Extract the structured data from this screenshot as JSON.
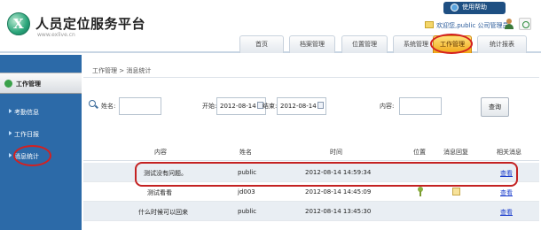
{
  "header": {
    "brand": "人员定位服务平台",
    "site": "www.exlive.cn",
    "help_label": "使用帮助",
    "welcome": "欢迎您,public 公司管理员"
  },
  "nav": {
    "tabs": [
      {
        "label": "首页",
        "active": false
      },
      {
        "label": "档案管理",
        "active": false
      },
      {
        "label": "位置管理",
        "active": false
      },
      {
        "label": "系统管理",
        "active": false
      },
      {
        "label": "工作管理",
        "active": true
      },
      {
        "label": "统计报表",
        "active": false
      }
    ]
  },
  "sidebar": {
    "header": "工作管理",
    "items": [
      {
        "label": "考勤信息"
      },
      {
        "label": "工作日报"
      },
      {
        "label": "消息统计"
      }
    ]
  },
  "breadcrumb": "工作管理 > 消息统计",
  "search": {
    "name_label": "姓名:",
    "name_value": "",
    "start_label": "开始:",
    "start_value": "2012-08-14",
    "end_label": "结束:",
    "end_value": "2012-08-14",
    "content_label": "内容:",
    "content_value": "",
    "query_button": "查询"
  },
  "table": {
    "headers": [
      "内容",
      "姓名",
      "时间",
      "位置",
      "消息回复",
      "相关消息"
    ],
    "rows": [
      {
        "content": "测试没有问题。",
        "name": "public",
        "time": "2012-08-14 14:59:34",
        "has_location": false,
        "has_reply": false,
        "action": "查看"
      },
      {
        "content": "测试看看",
        "name": "jd003",
        "time": "2012-08-14 14:45:09",
        "has_location": true,
        "has_reply": true,
        "action": "查看"
      },
      {
        "content": "什么时候可以回来",
        "name": "public",
        "time": "2012-08-14 13:45:30",
        "has_location": false,
        "has_reply": false,
        "action": "查看"
      }
    ]
  },
  "colors": {
    "sidebar_bg": "#2c6aa8",
    "active_tab": "#f0a81a",
    "highlight_ring": "#d42020",
    "link": "#1a3ccc"
  }
}
